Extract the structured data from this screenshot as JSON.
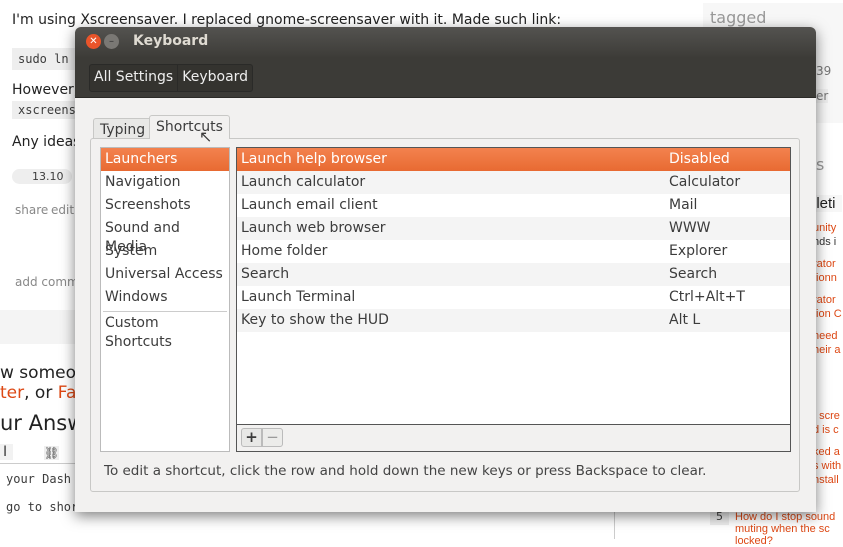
{
  "background": {
    "question_text": "I'm using Xscreensaver. I replaced gnome-screensaver with it. Made such link:",
    "code1": "sudo ln",
    "however": "However,",
    "code2": "xscreens",
    "any_ideas": "Any ideas?",
    "tag": "13.10",
    "share": "share",
    "edit": "edit",
    "add_comment": "add comme",
    "know_someone": "w someon",
    "twitter": "ter",
    "or": ", or ",
    "facebook": "Fa",
    "your_answer": "ur Answe",
    "italic_btn": "I",
    "editor_line1": "your Dash",
    "editor_line2": "go to shortcuts tab",
    "sidebar_tagged": "tagged",
    "sidebar_count": "39",
    "sidebar_tag": "er",
    "sidebar_heading1": "s",
    "sidebar_heading2": "lleti",
    "sidebar_links": [
      "unity",
      "nds i",
      "rator",
      "tionn",
      "rator",
      "tion C",
      "need",
      "heir a",
      "t scre",
      "d is c",
      "ked a",
      "s with",
      "nstall"
    ],
    "related_num": "5",
    "related_q": "How do I stop sound muting when the sc",
    "related_q2": "locked?"
  },
  "dialog": {
    "title": "Keyboard",
    "breadcrumbs": [
      "All Settings",
      "Keyboard"
    ],
    "tabs": [
      "Typing",
      "Shortcuts"
    ],
    "active_tab": "Shortcuts",
    "categories": [
      "Launchers",
      "Navigation",
      "Screenshots",
      "Sound and Media",
      "System",
      "Universal Access",
      "Windows"
    ],
    "custom_category": "Custom Shortcuts",
    "selected_category": "Launchers",
    "shortcuts": [
      {
        "action": "Launch help browser",
        "key": "Disabled"
      },
      {
        "action": "Launch calculator",
        "key": "Calculator"
      },
      {
        "action": "Launch email client",
        "key": "Mail"
      },
      {
        "action": "Launch web browser",
        "key": "WWW"
      },
      {
        "action": "Home folder",
        "key": "Explorer"
      },
      {
        "action": "Search",
        "key": "Search"
      },
      {
        "action": "Launch Terminal",
        "key": "Ctrl+Alt+T"
      },
      {
        "action": "Key to show the HUD",
        "key": "Alt L"
      }
    ],
    "add_label": "+",
    "remove_label": "−",
    "hint": "To edit a shortcut, click the row and hold down the new keys or press Backspace to clear.",
    "accent": "#e96f35"
  }
}
